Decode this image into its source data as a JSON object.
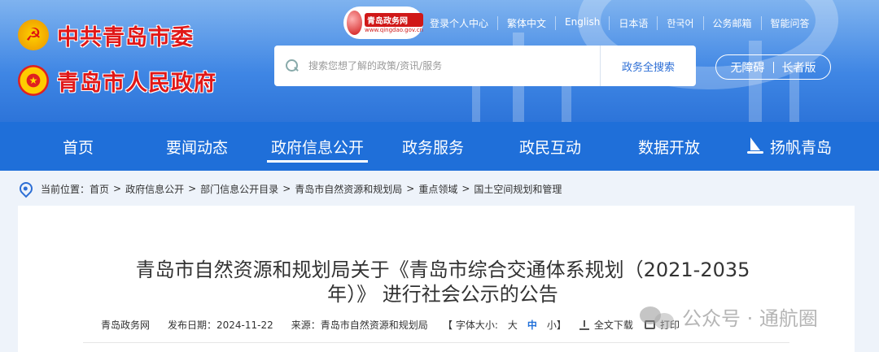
{
  "header": {
    "party_title": "中共青岛市委",
    "gov_title": "青岛市人民政府",
    "portal_logo": {
      "name": "青岛政务网",
      "sub": "www.qingdao.gov.cn"
    },
    "top_links": [
      "登录个人中心",
      "繁体中文",
      "English",
      "日本语",
      "한국어",
      "公务邮箱",
      "智能问答"
    ],
    "search": {
      "placeholder": "搜索您想了解的政策/资讯/服务",
      "button": "政务全搜索"
    },
    "accessibility": {
      "barrier_free": "无障碍",
      "elderly": "长者版"
    }
  },
  "nav": {
    "items": [
      {
        "label": "首页",
        "active": false
      },
      {
        "label": "要闻动态",
        "active": false
      },
      {
        "label": "政府信息公开",
        "active": true
      },
      {
        "label": "政务服务",
        "active": false
      },
      {
        "label": "政民互动",
        "active": false
      },
      {
        "label": "数据开放",
        "active": false
      },
      {
        "label": "扬帆青岛",
        "active": false
      }
    ]
  },
  "breadcrumb": {
    "prefix": "当前位置：",
    "items": [
      "首页",
      "政府信息公开",
      "部门信息公开目录",
      "青岛市自然资源和规划局",
      "重点领域",
      "国土空间规划和管理"
    ]
  },
  "article": {
    "title": "青岛市自然资源和规划局关于《青岛市综合交通体系规划（2021-2035年）》 进行社会公示的公告",
    "source_site": "青岛政务网",
    "publish_date": "发布日期：2024-11-22",
    "origin": "来源：青岛市自然资源和规划局",
    "font_size_label": "【 字体大小: ",
    "font_sizes": [
      "大",
      "中",
      "小"
    ],
    "font_size_close": " 】",
    "download": "全文下载",
    "print": "打印"
  },
  "watermark": "公众号 · 通航圈",
  "colors": {
    "primary": "#1f6fd9",
    "header_top": "#7fb3ef",
    "title_red": "#e01818"
  }
}
